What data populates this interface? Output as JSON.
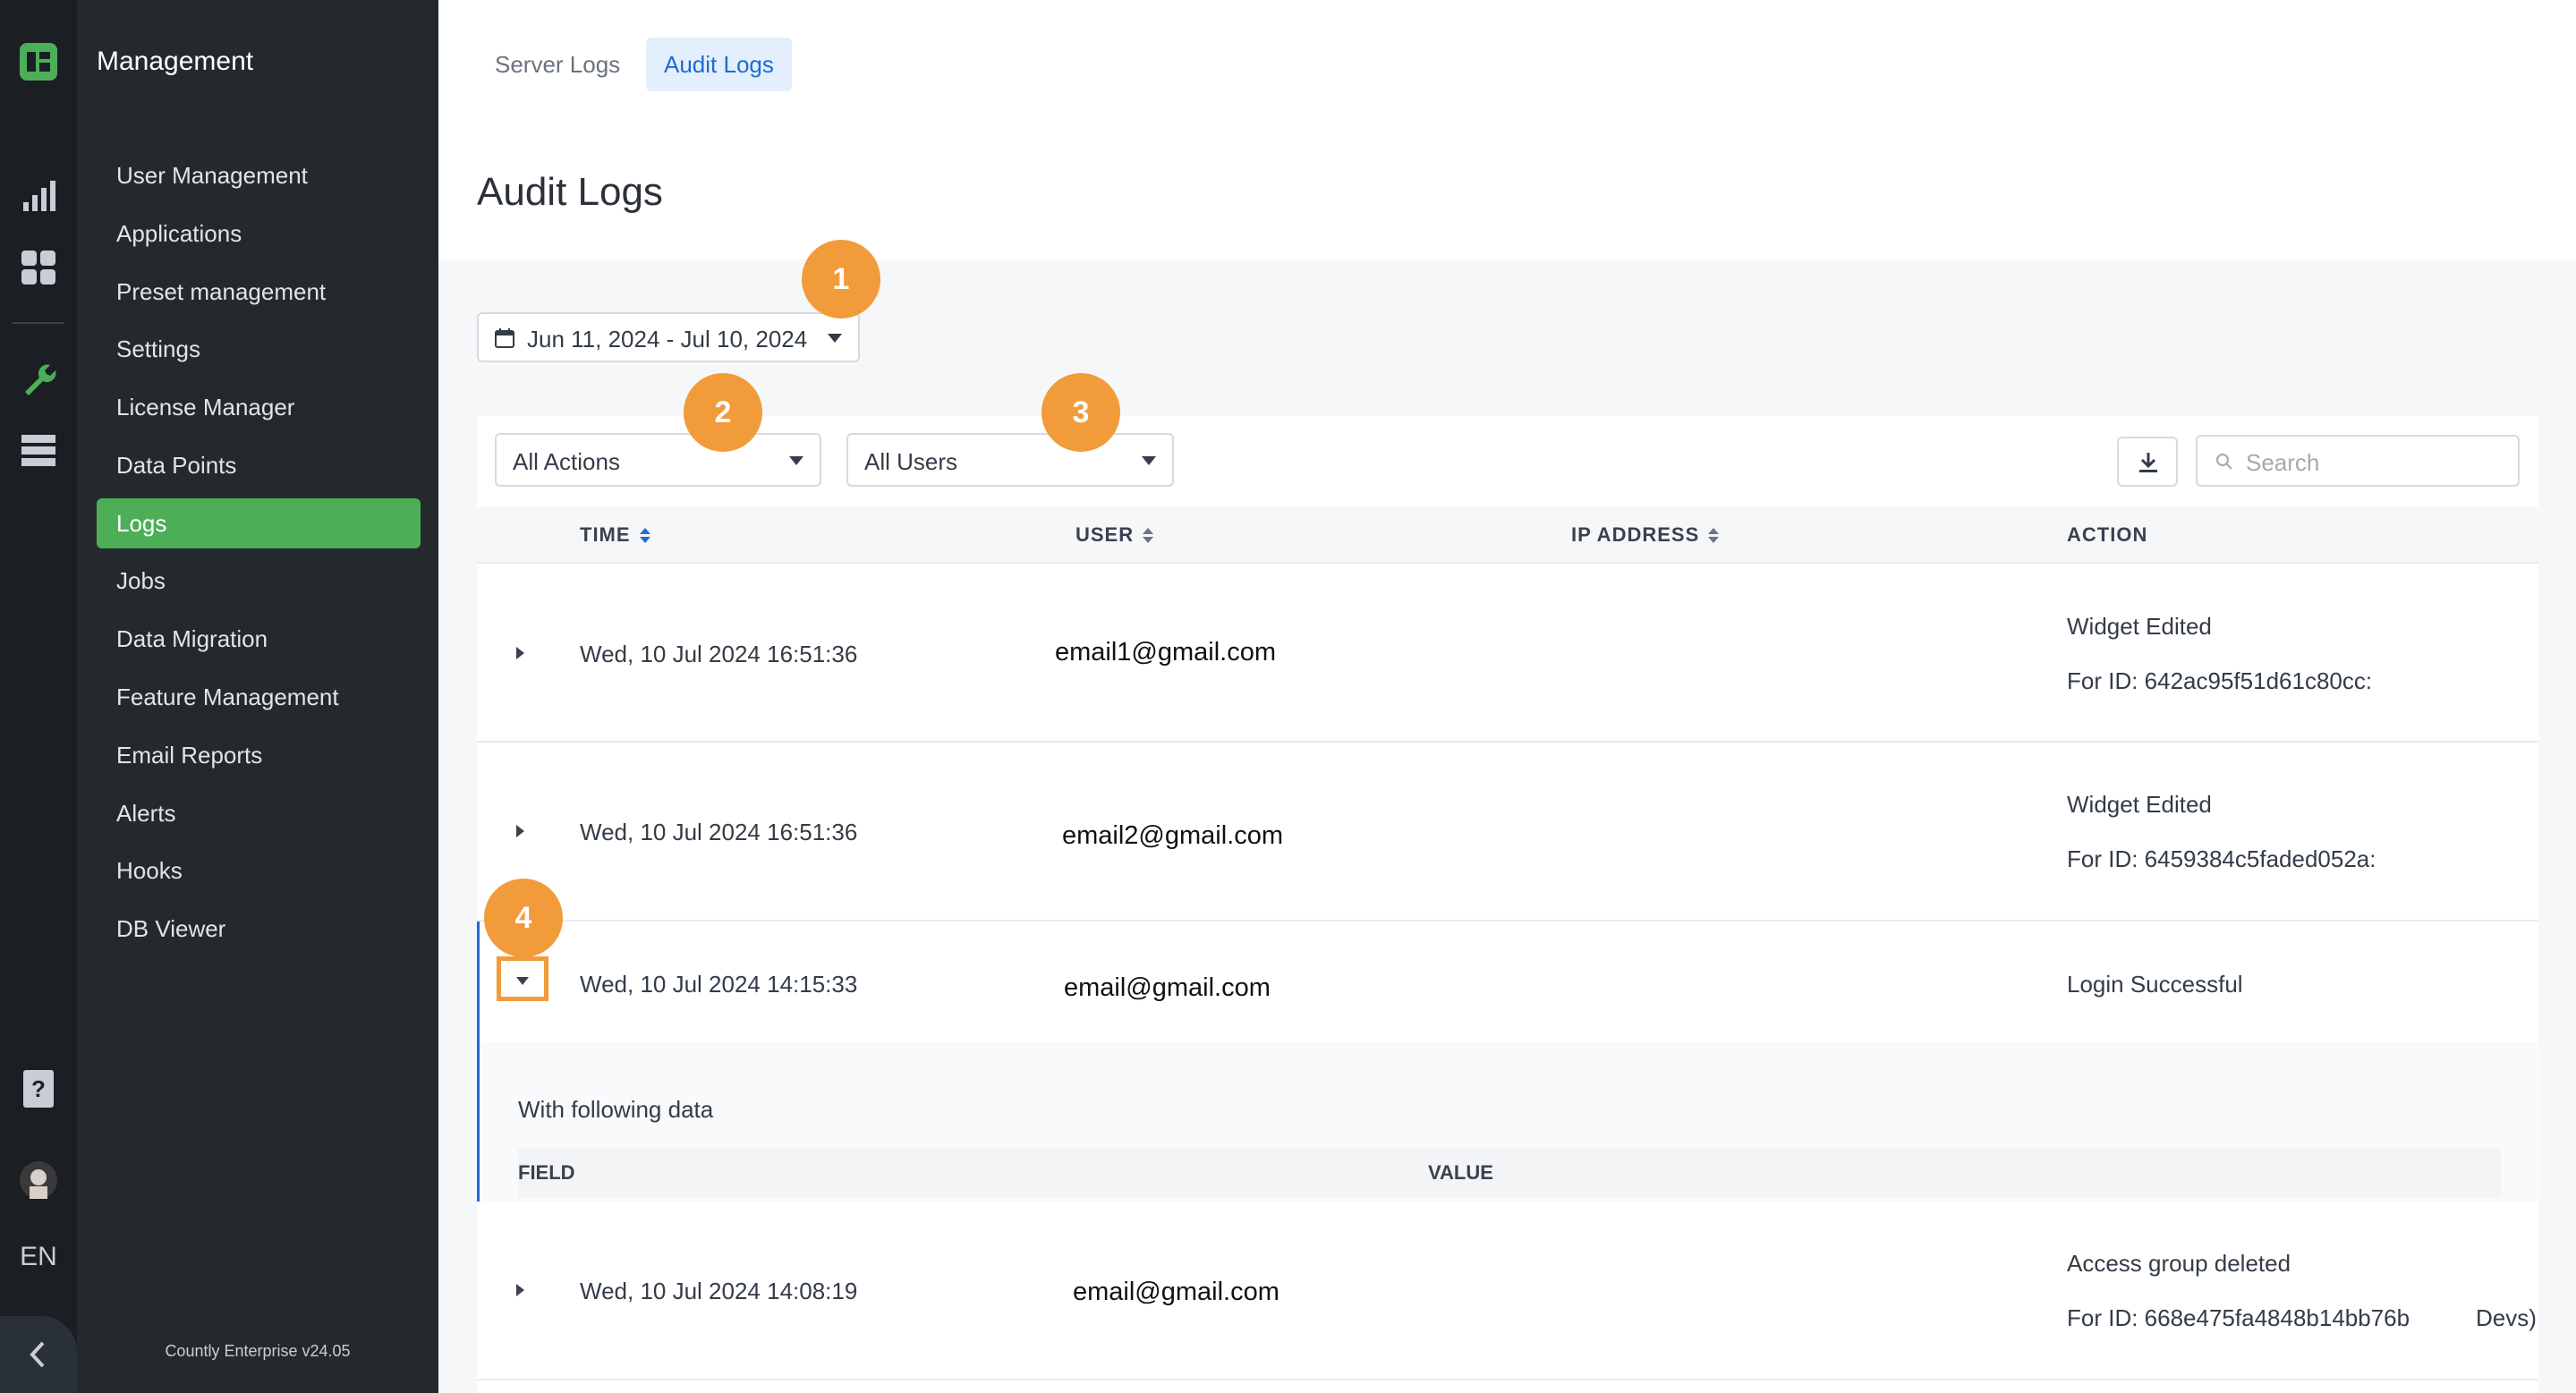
{
  "rail": {
    "language": "EN"
  },
  "sidebar": {
    "title": "Management",
    "items": [
      {
        "label": "User Management"
      },
      {
        "label": "Applications"
      },
      {
        "label": "Preset management"
      },
      {
        "label": "Settings"
      },
      {
        "label": "License Manager"
      },
      {
        "label": "Data Points"
      },
      {
        "label": "Logs",
        "active": true
      },
      {
        "label": "Jobs"
      },
      {
        "label": "Data Migration"
      },
      {
        "label": "Feature Management"
      },
      {
        "label": "Email Reports"
      },
      {
        "label": "Alerts"
      },
      {
        "label": "Hooks"
      },
      {
        "label": "DB Viewer"
      }
    ],
    "footer": "Countly Enterprise v24.05"
  },
  "tabs": [
    {
      "label": "Server Logs",
      "active": false
    },
    {
      "label": "Audit Logs",
      "active": true
    }
  ],
  "page_title": "Audit Logs",
  "date_range": "Jun 11, 2024 - Jul 10, 2024",
  "filters": {
    "actions": "All Actions",
    "users": "All Users"
  },
  "search": {
    "placeholder": "Search"
  },
  "table": {
    "headers": {
      "time": "TIME",
      "user": "USER",
      "ip": "IP ADDRESS",
      "action": "ACTION"
    },
    "rows": [
      {
        "time": "Wed, 10 Jul 2024 16:51:36",
        "user": "email1@gmail.com",
        "action": "Widget Edited",
        "detail": "For ID: 642ac95f51d61c80cc:"
      },
      {
        "time": "Wed, 10 Jul 2024 16:51:36",
        "user": "email2@gmail.com",
        "action": "Widget Edited",
        "detail": "For ID: 6459384c5faded052a:"
      },
      {
        "time": "Wed, 10 Jul 2024 14:15:33",
        "user": "email@gmail.com",
        "action": "Login Successful",
        "detail": ""
      },
      {
        "time": "Wed, 10 Jul 2024 14:08:19",
        "user": "email@gmail.com",
        "action": "Access group deleted",
        "detail": "For ID: 668e475fa4848b14bb76b",
        "extra": "Devs)"
      }
    ],
    "expanded": {
      "title": "With following data",
      "field_header": "FIELD",
      "value_header": "VALUE"
    }
  },
  "markers": [
    "1",
    "2",
    "3",
    "4"
  ],
  "colors": {
    "accent_green": "#4caf58",
    "marker_orange": "#f29b3a",
    "link_blue": "#1e6bd6"
  }
}
